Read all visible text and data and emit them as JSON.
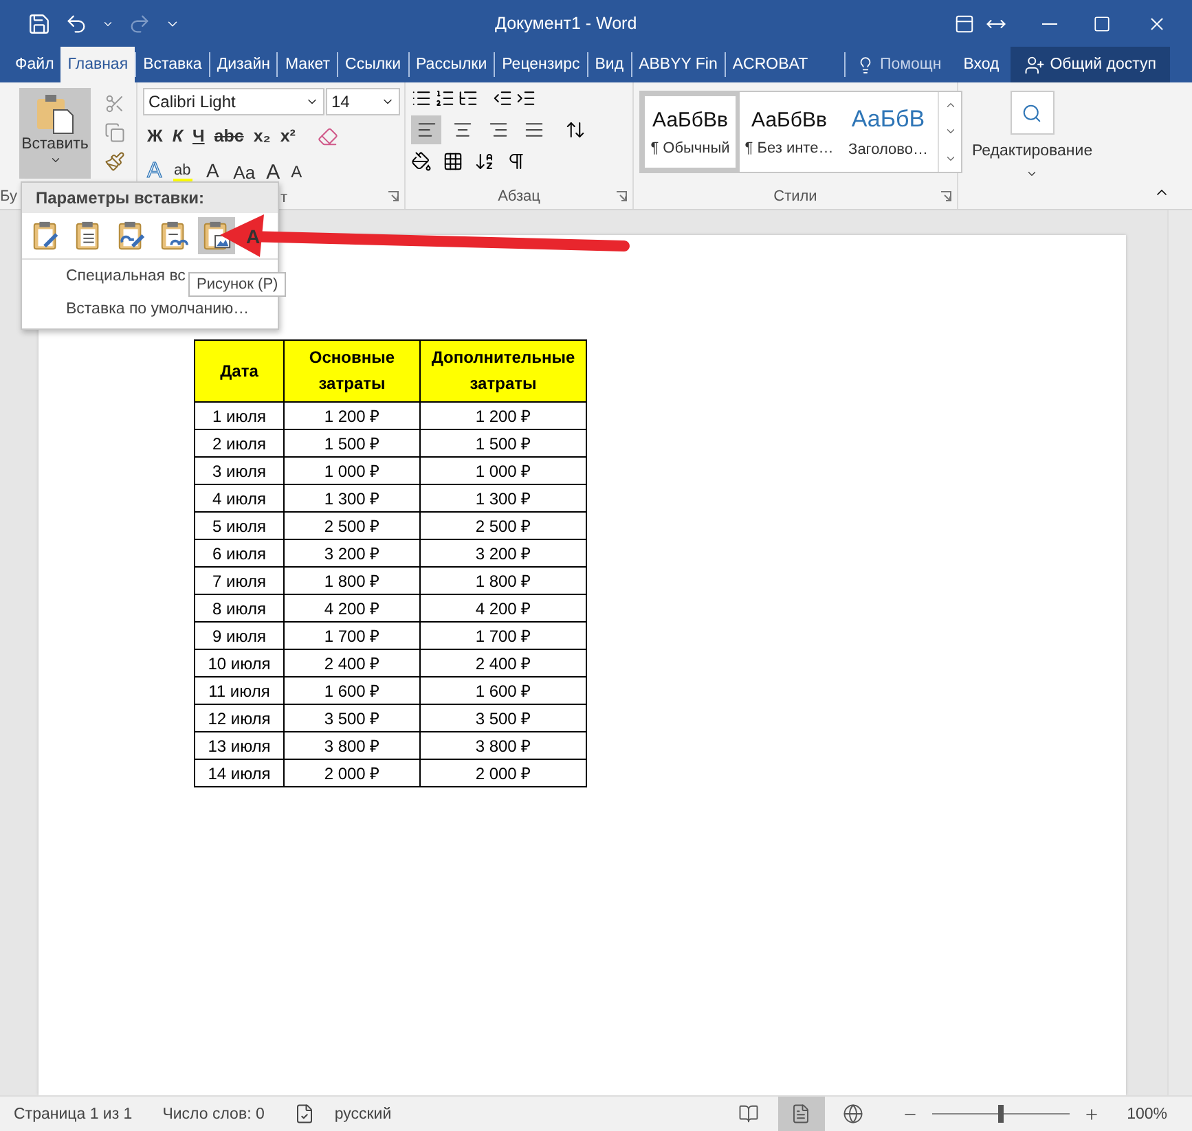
{
  "window": {
    "title": "Документ1 - Word"
  },
  "tabs": [
    {
      "label": "Файл",
      "selected": false
    },
    {
      "label": "Главная",
      "selected": true
    },
    {
      "label": "Вставка",
      "selected": false
    },
    {
      "label": "Дизайн",
      "selected": false
    },
    {
      "label": "Макет",
      "selected": false
    },
    {
      "label": "Ссылки",
      "selected": false
    },
    {
      "label": "Рассылки",
      "selected": false
    },
    {
      "label": "Рецензирс",
      "selected": false
    },
    {
      "label": "Вид",
      "selected": false
    },
    {
      "label": "ABBYY Fin",
      "selected": false
    },
    {
      "label": "ACROBAT",
      "selected": false
    }
  ],
  "tell_me": "Помощн",
  "sign_in": "Вход",
  "share": "Общий доступ",
  "ribbon": {
    "clipboard": {
      "paste_label": "Вставить",
      "group_label": "Бу"
    },
    "font": {
      "font_name": "Calibri Light",
      "font_size": "14",
      "format_buttons": [
        "Ж",
        "К",
        "Ч",
        "abc",
        "x₂",
        "x²"
      ],
      "effect_buttons": [
        {
          "kind": "effects",
          "glyph": "A"
        },
        {
          "kind": "highlight",
          "glyph": "ab"
        },
        {
          "kind": "color",
          "glyph": "A"
        },
        {
          "kind": "case",
          "glyph": "Aa"
        },
        {
          "kind": "grow",
          "glyph": "A"
        },
        {
          "kind": "shrink",
          "glyph": "A"
        }
      ],
      "group_label": "т"
    },
    "paragraph": {
      "alignments": [
        {
          "kind": "left",
          "selected": true
        },
        {
          "kind": "center",
          "selected": false
        },
        {
          "kind": "right",
          "selected": false
        },
        {
          "kind": "justify",
          "selected": false
        }
      ],
      "group_label": "Абзац"
    },
    "styles": {
      "items": [
        {
          "preview": "АаБбВв",
          "name": "¶ Обычный",
          "kind": "normal",
          "selected": true
        },
        {
          "preview": "АаБбВв",
          "name": "¶ Без инте…",
          "kind": "normal",
          "selected": false
        },
        {
          "preview": "АаБбВ",
          "name": "Заголово…",
          "kind": "heading",
          "selected": false
        }
      ],
      "group_label": "Стили"
    },
    "editing": {
      "label": "Редактирование"
    }
  },
  "paste_menu": {
    "title": "Параметры вставки:",
    "options": [
      {
        "kind": "source",
        "selected": false
      },
      {
        "kind": "merge",
        "selected": false
      },
      {
        "kind": "link-source",
        "selected": false
      },
      {
        "kind": "link-merge",
        "selected": false
      },
      {
        "kind": "picture",
        "selected": true
      }
    ],
    "partial_glyph": "A",
    "items": [
      "Специальная вс",
      "Вставка по умолчанию…"
    ],
    "tooltip": "Рисунок (P)"
  },
  "table": {
    "columns": [
      "Дата",
      "Основные затраты",
      "Дополнительные затраты"
    ],
    "rows": [
      [
        "1 июля",
        "1 200 ₽",
        "1 200 ₽"
      ],
      [
        "2 июля",
        "1 500 ₽",
        "1 500 ₽"
      ],
      [
        "3 июля",
        "1 000 ₽",
        "1 000 ₽"
      ],
      [
        "4 июля",
        "1 300 ₽",
        "1 300 ₽"
      ],
      [
        "5 июля",
        "2 500 ₽",
        "2 500 ₽"
      ],
      [
        "6 июля",
        "3 200 ₽",
        "3 200 ₽"
      ],
      [
        "7 июля",
        "1 800 ₽",
        "1 800 ₽"
      ],
      [
        "8 июля",
        "4 200 ₽",
        "4 200 ₽"
      ],
      [
        "9 июля",
        "1 700 ₽",
        "1 700 ₽"
      ],
      [
        "10 июля",
        "2 400 ₽",
        "2 400 ₽"
      ],
      [
        "11 июля",
        "1 600 ₽",
        "1 600 ₽"
      ],
      [
        "12 июля",
        "3 500 ₽",
        "3 500 ₽"
      ],
      [
        "13 июля",
        "3 800 ₽",
        "3 800 ₽"
      ],
      [
        "14 июля",
        "2 000 ₽",
        "2 000 ₽"
      ]
    ]
  },
  "status_bar": {
    "page": "Страница 1 из 1",
    "words": "Число слов: 0",
    "language": "русский",
    "views": [
      {
        "kind": "read",
        "selected": false
      },
      {
        "kind": "print",
        "selected": true
      },
      {
        "kind": "web",
        "selected": false
      }
    ],
    "zoom": {
      "level": 0.5,
      "reading": "100%"
    }
  }
}
